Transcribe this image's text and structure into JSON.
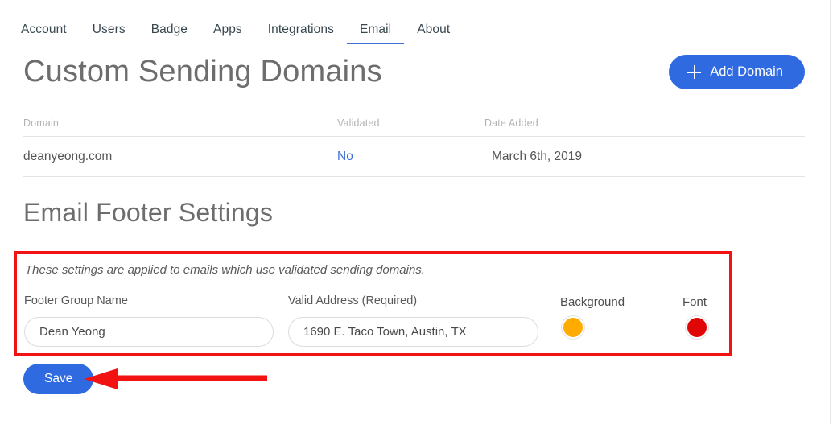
{
  "nav": {
    "tabs": [
      {
        "label": "Account",
        "active": false
      },
      {
        "label": "Users",
        "active": false
      },
      {
        "label": "Badge",
        "active": false
      },
      {
        "label": "Apps",
        "active": false
      },
      {
        "label": "Integrations",
        "active": false
      },
      {
        "label": "Email",
        "active": true
      },
      {
        "label": "About",
        "active": false
      }
    ],
    "active_tab": "Email",
    "active_underline_color": "#3b6fd4"
  },
  "domains_section": {
    "title": "Custom Sending Domains",
    "add_button": {
      "label": "Add Domain",
      "icon": "plus-icon",
      "color": "#2f6ae1"
    },
    "table": {
      "headers": [
        "Domain",
        "Validated",
        "Date Added"
      ],
      "rows": [
        {
          "domain": "deanyeong.com",
          "validated": "No",
          "validated_color": "#3b6fd4",
          "date_added": "March 6th, 2019"
        }
      ]
    }
  },
  "footer_settings": {
    "title": "Email Footer Settings",
    "note": "These settings are applied to emails which use validated sending domains.",
    "highlight_color": "#f31212",
    "fields": {
      "group_name": {
        "label": "Footer Group Name",
        "value": "Dean Yeong",
        "placeholder": "Footer Group Name"
      },
      "valid_address": {
        "label": "Valid Address (Required)",
        "value": "1690 E. Taco Town, Austin, TX",
        "placeholder": "Valid Address"
      },
      "background": {
        "label": "Background",
        "color": "#ffab00"
      },
      "font": {
        "label": "Font",
        "color": "#e00606"
      }
    },
    "save_button": {
      "label": "Save",
      "color": "#2f6ae1"
    },
    "annotation_arrow_color": "#f31212"
  }
}
